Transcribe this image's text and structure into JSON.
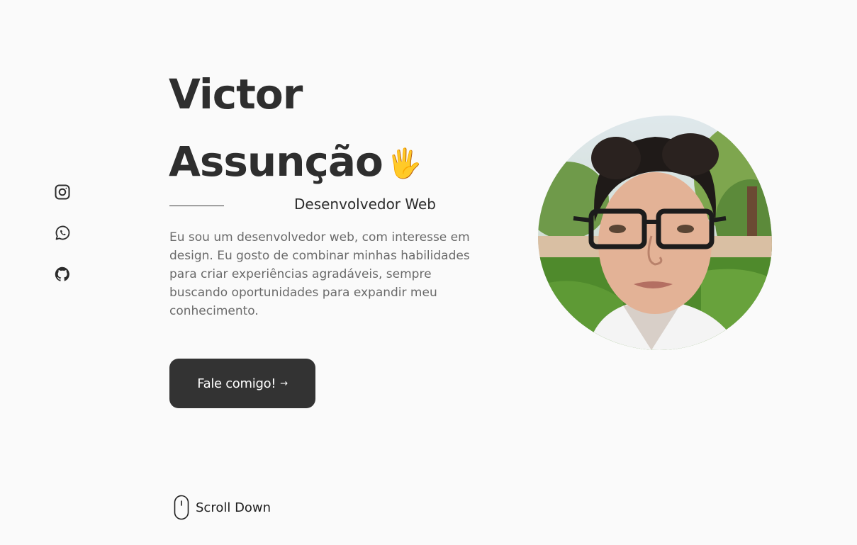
{
  "social": {
    "links": [
      {
        "icon": "instagram-icon"
      },
      {
        "icon": "whatsapp-icon"
      },
      {
        "icon": "github-icon"
      }
    ]
  },
  "hero": {
    "first_name": "Victor",
    "last_name": "Assunção",
    "emoji": "🖐",
    "subtitle": "Desenvolvedor Web",
    "description": "Eu sou um desenvolvedor web, com interesse em design. Eu gosto de combinar minhas habilidades para criar experiências agradáveis, sempre buscando oportunidades para expandir meu conhecimento.",
    "button_label": "Fale comigo!",
    "button_arrow": "→"
  },
  "scroll": {
    "label": "Scroll Down",
    "icon": "mouse-icon"
  },
  "profile": {
    "image": "profile-photo"
  },
  "colors": {
    "background": "#fafafa",
    "text": "#2e2e2e",
    "muted": "#6a6a6a",
    "button": "#333333",
    "button_text": "#ffffff"
  }
}
